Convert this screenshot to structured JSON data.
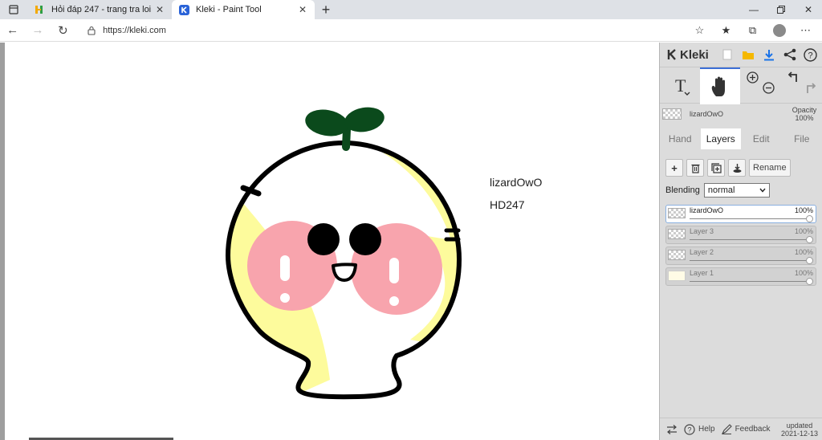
{
  "browser": {
    "tabs": [
      {
        "title": "Hỏi đáp 247 - trang tra loi",
        "active": false
      },
      {
        "title": "Kleki - Paint Tool",
        "active": true
      }
    ],
    "url": "https://kleki.com",
    "new_tab_symbol": "+",
    "close_symbol": "✕"
  },
  "canvas": {
    "text_line1": "lizardOwO",
    "text_line2": "HD247",
    "colors": {
      "outline": "#000000",
      "sprout": "#0b4a1c",
      "yellow": "#fdfb9c",
      "blush": "#f8a4ad"
    }
  },
  "panel": {
    "logo": "Kleki",
    "current_layer": {
      "name": "lizardOwO",
      "opacity_label": "Opacity",
      "opacity_value": "100%"
    },
    "tabs": [
      "Hand",
      "Layers",
      "Edit",
      "File"
    ],
    "active_tab": "Layers",
    "rename_label": "Rename",
    "blending_label": "Blending",
    "blending_value": "normal",
    "layers": [
      {
        "name": "lizardOwO",
        "opacity": "100%",
        "active": true
      },
      {
        "name": "Layer 3",
        "opacity": "100%",
        "active": false
      },
      {
        "name": "Layer 2",
        "opacity": "100%",
        "active": false
      },
      {
        "name": "Layer 1",
        "opacity": "100%",
        "active": false
      }
    ],
    "footer": {
      "help": "Help",
      "feedback": "Feedback",
      "updated_label": "updated",
      "updated_date": "2021-12-13"
    },
    "accent_color": "#3d6fd6"
  }
}
